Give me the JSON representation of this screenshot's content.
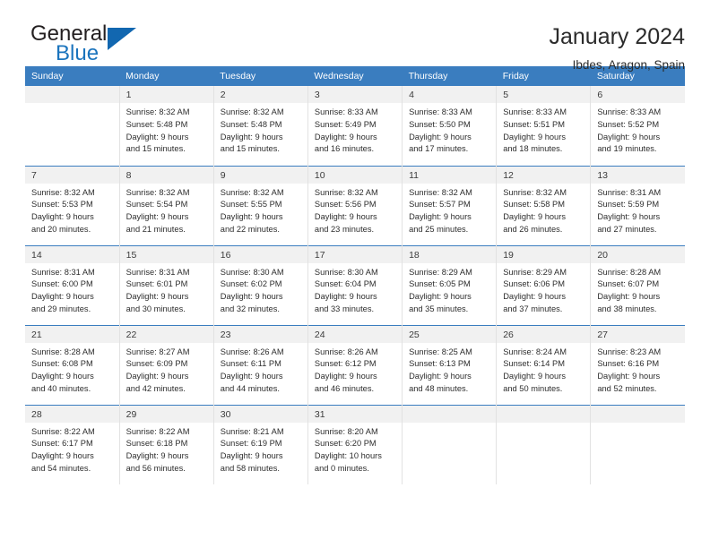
{
  "brand": {
    "name_part1": "General",
    "name_part2": "Blue",
    "triangle_color": "#1267b0",
    "blue_color": "#1b74bd"
  },
  "header": {
    "title": "January 2024",
    "location": "Ibdes, Aragon, Spain"
  },
  "calendar": {
    "header_bg": "#3a7dbf",
    "header_text_color": "#ffffff",
    "daynum_bg": "#f1f1f1",
    "weekday_headers": [
      "Sunday",
      "Monday",
      "Tuesday",
      "Wednesday",
      "Thursday",
      "Friday",
      "Saturday"
    ],
    "weeks": [
      [
        {
          "day": "",
          "lines": []
        },
        {
          "day": "1",
          "lines": [
            "Sunrise: 8:32 AM",
            "Sunset: 5:48 PM",
            "Daylight: 9 hours",
            "and 15 minutes."
          ]
        },
        {
          "day": "2",
          "lines": [
            "Sunrise: 8:32 AM",
            "Sunset: 5:48 PM",
            "Daylight: 9 hours",
            "and 15 minutes."
          ]
        },
        {
          "day": "3",
          "lines": [
            "Sunrise: 8:33 AM",
            "Sunset: 5:49 PM",
            "Daylight: 9 hours",
            "and 16 minutes."
          ]
        },
        {
          "day": "4",
          "lines": [
            "Sunrise: 8:33 AM",
            "Sunset: 5:50 PM",
            "Daylight: 9 hours",
            "and 17 minutes."
          ]
        },
        {
          "day": "5",
          "lines": [
            "Sunrise: 8:33 AM",
            "Sunset: 5:51 PM",
            "Daylight: 9 hours",
            "and 18 minutes."
          ]
        },
        {
          "day": "6",
          "lines": [
            "Sunrise: 8:33 AM",
            "Sunset: 5:52 PM",
            "Daylight: 9 hours",
            "and 19 minutes."
          ]
        }
      ],
      [
        {
          "day": "7",
          "lines": [
            "Sunrise: 8:32 AM",
            "Sunset: 5:53 PM",
            "Daylight: 9 hours",
            "and 20 minutes."
          ]
        },
        {
          "day": "8",
          "lines": [
            "Sunrise: 8:32 AM",
            "Sunset: 5:54 PM",
            "Daylight: 9 hours",
            "and 21 minutes."
          ]
        },
        {
          "day": "9",
          "lines": [
            "Sunrise: 8:32 AM",
            "Sunset: 5:55 PM",
            "Daylight: 9 hours",
            "and 22 minutes."
          ]
        },
        {
          "day": "10",
          "lines": [
            "Sunrise: 8:32 AM",
            "Sunset: 5:56 PM",
            "Daylight: 9 hours",
            "and 23 minutes."
          ]
        },
        {
          "day": "11",
          "lines": [
            "Sunrise: 8:32 AM",
            "Sunset: 5:57 PM",
            "Daylight: 9 hours",
            "and 25 minutes."
          ]
        },
        {
          "day": "12",
          "lines": [
            "Sunrise: 8:32 AM",
            "Sunset: 5:58 PM",
            "Daylight: 9 hours",
            "and 26 minutes."
          ]
        },
        {
          "day": "13",
          "lines": [
            "Sunrise: 8:31 AM",
            "Sunset: 5:59 PM",
            "Daylight: 9 hours",
            "and 27 minutes."
          ]
        }
      ],
      [
        {
          "day": "14",
          "lines": [
            "Sunrise: 8:31 AM",
            "Sunset: 6:00 PM",
            "Daylight: 9 hours",
            "and 29 minutes."
          ]
        },
        {
          "day": "15",
          "lines": [
            "Sunrise: 8:31 AM",
            "Sunset: 6:01 PM",
            "Daylight: 9 hours",
            "and 30 minutes."
          ]
        },
        {
          "day": "16",
          "lines": [
            "Sunrise: 8:30 AM",
            "Sunset: 6:02 PM",
            "Daylight: 9 hours",
            "and 32 minutes."
          ]
        },
        {
          "day": "17",
          "lines": [
            "Sunrise: 8:30 AM",
            "Sunset: 6:04 PM",
            "Daylight: 9 hours",
            "and 33 minutes."
          ]
        },
        {
          "day": "18",
          "lines": [
            "Sunrise: 8:29 AM",
            "Sunset: 6:05 PM",
            "Daylight: 9 hours",
            "and 35 minutes."
          ]
        },
        {
          "day": "19",
          "lines": [
            "Sunrise: 8:29 AM",
            "Sunset: 6:06 PM",
            "Daylight: 9 hours",
            "and 37 minutes."
          ]
        },
        {
          "day": "20",
          "lines": [
            "Sunrise: 8:28 AM",
            "Sunset: 6:07 PM",
            "Daylight: 9 hours",
            "and 38 minutes."
          ]
        }
      ],
      [
        {
          "day": "21",
          "lines": [
            "Sunrise: 8:28 AM",
            "Sunset: 6:08 PM",
            "Daylight: 9 hours",
            "and 40 minutes."
          ]
        },
        {
          "day": "22",
          "lines": [
            "Sunrise: 8:27 AM",
            "Sunset: 6:09 PM",
            "Daylight: 9 hours",
            "and 42 minutes."
          ]
        },
        {
          "day": "23",
          "lines": [
            "Sunrise: 8:26 AM",
            "Sunset: 6:11 PM",
            "Daylight: 9 hours",
            "and 44 minutes."
          ]
        },
        {
          "day": "24",
          "lines": [
            "Sunrise: 8:26 AM",
            "Sunset: 6:12 PM",
            "Daylight: 9 hours",
            "and 46 minutes."
          ]
        },
        {
          "day": "25",
          "lines": [
            "Sunrise: 8:25 AM",
            "Sunset: 6:13 PM",
            "Daylight: 9 hours",
            "and 48 minutes."
          ]
        },
        {
          "day": "26",
          "lines": [
            "Sunrise: 8:24 AM",
            "Sunset: 6:14 PM",
            "Daylight: 9 hours",
            "and 50 minutes."
          ]
        },
        {
          "day": "27",
          "lines": [
            "Sunrise: 8:23 AM",
            "Sunset: 6:16 PM",
            "Daylight: 9 hours",
            "and 52 minutes."
          ]
        }
      ],
      [
        {
          "day": "28",
          "lines": [
            "Sunrise: 8:22 AM",
            "Sunset: 6:17 PM",
            "Daylight: 9 hours",
            "and 54 minutes."
          ]
        },
        {
          "day": "29",
          "lines": [
            "Sunrise: 8:22 AM",
            "Sunset: 6:18 PM",
            "Daylight: 9 hours",
            "and 56 minutes."
          ]
        },
        {
          "day": "30",
          "lines": [
            "Sunrise: 8:21 AM",
            "Sunset: 6:19 PM",
            "Daylight: 9 hours",
            "and 58 minutes."
          ]
        },
        {
          "day": "31",
          "lines": [
            "Sunrise: 8:20 AM",
            "Sunset: 6:20 PM",
            "Daylight: 10 hours",
            "and 0 minutes."
          ]
        },
        {
          "day": "",
          "lines": []
        },
        {
          "day": "",
          "lines": []
        },
        {
          "day": "",
          "lines": []
        }
      ]
    ]
  }
}
